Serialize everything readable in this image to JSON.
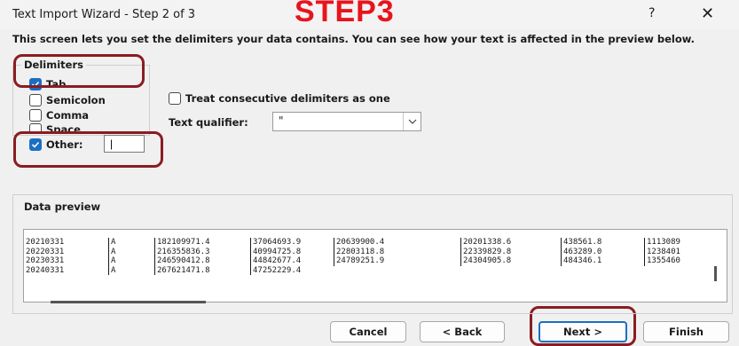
{
  "window": {
    "title": "Text Import Wizard - Step 2 of 3",
    "overlay_annotation": "STEP3",
    "help_label": "?",
    "close_label": "✕"
  },
  "description": "This screen lets you set the delimiters your data contains.  You can see how your text is affected in the preview below.",
  "delimiters": {
    "group_label": "Delimiters",
    "tab": {
      "label": "Tab",
      "checked": true
    },
    "semicolon": {
      "label": "Semicolon",
      "checked": false
    },
    "comma": {
      "label": "Comma",
      "checked": false
    },
    "space": {
      "label": "Space",
      "checked": false
    },
    "other": {
      "label": "Other:",
      "checked": true,
      "value": "|"
    }
  },
  "consecutive": {
    "label": "Treat consecutive delimiters as one",
    "checked": false
  },
  "text_qualifier": {
    "label": "Text qualifier:",
    "value": "\""
  },
  "preview": {
    "group_label": "Data preview",
    "columns": [
      [
        "20210331",
        "20220331",
        "20230331",
        "20240331"
      ],
      [
        "A",
        "A",
        "A",
        "A"
      ],
      [
        "182109971.4",
        "216355836.3",
        "246590412.8",
        "267621471.8"
      ],
      [
        "37064693.9",
        "40994725.8",
        "44842677.4",
        "47252229.4"
      ],
      [
        "20639900.4",
        "22803118.8",
        "24789251.9",
        ""
      ],
      [
        "20201338.6",
        "22339829.8",
        "24304905.8",
        ""
      ],
      [
        "438561.8",
        "463289.0",
        "484346.1",
        ""
      ],
      [
        "1113089",
        "1238401",
        "1355460",
        ""
      ]
    ]
  },
  "buttons": {
    "cancel": "Cancel",
    "back": "< Back",
    "next": "Next >",
    "finish": "Finish"
  },
  "colors": {
    "accent": "#1a6fc4",
    "annotation_red": "#e8141c",
    "annotation_box": "#8a1c22"
  }
}
